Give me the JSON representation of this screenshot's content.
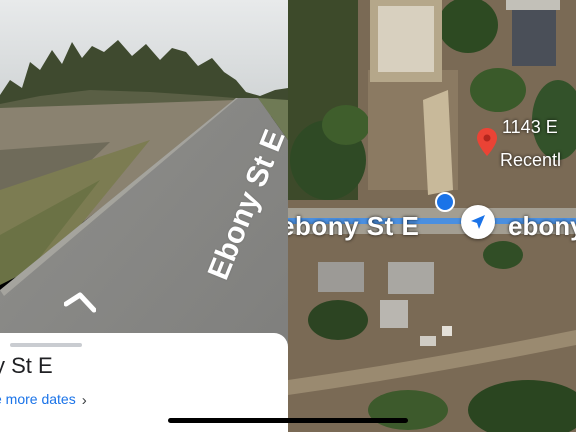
{
  "street_view": {
    "road_label": "Ebony St E",
    "card": {
      "title": "y St E",
      "see_more": "e more dates",
      "chevron": "›"
    },
    "icons": [
      "navigate-forward-chevron-icon"
    ]
  },
  "map": {
    "road_label": "ebony St E",
    "road_label_continued": "ebony St E",
    "place": {
      "title": "1143 E",
      "subtitle": "Recentl",
      "pin_color": "#ea4335"
    },
    "location_dot_color": "#1a73e8",
    "icons": [
      "place-pin-icon",
      "location-dot-icon",
      "navigation-arrow-icon"
    ]
  }
}
